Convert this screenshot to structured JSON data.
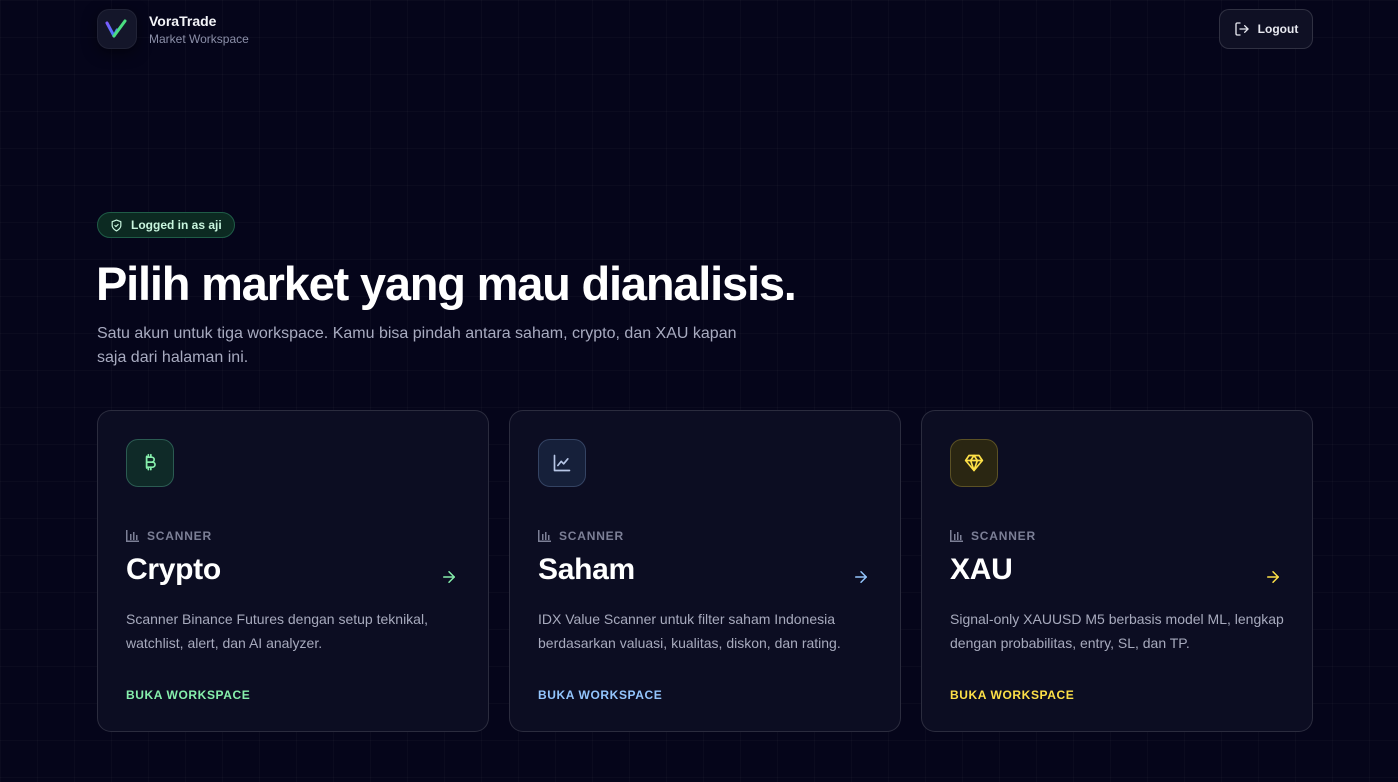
{
  "header": {
    "brand_name": "VoraTrade",
    "brand_sub": "Market Workspace",
    "logout_label": "Logout"
  },
  "hero": {
    "badge": "Logged in as aji",
    "title": "Pilih market yang mau dianalisis.",
    "subtitle": "Satu akun untuk tiga workspace. Kamu bisa pindah antara saham, crypto, dan XAU kapan saja dari halaman ini."
  },
  "cards": [
    {
      "icon": "bitcoin-icon",
      "tag": "SCANNER",
      "title": "Crypto",
      "description": "Scanner Binance Futures dengan setup teknikal, watchlist, alert, dan AI analyzer.",
      "cta": "BUKA WORKSPACE",
      "accent": "#86efac"
    },
    {
      "icon": "line-chart-icon",
      "tag": "SCANNER",
      "title": "Saham",
      "description": "IDX Value Scanner untuk filter saham Indonesia berdasarkan valuasi, kualitas, diskon, dan rating.",
      "cta": "BUKA WORKSPACE",
      "accent": "#93c5fd"
    },
    {
      "icon": "gem-icon",
      "tag": "SCANNER",
      "title": "XAU",
      "description": "Signal-only XAUUSD M5 berbasis model ML, lengkap dengan probabilitas, entry, SL, dan TP.",
      "cta": "BUKA WORKSPACE",
      "accent": "#fde047"
    }
  ]
}
